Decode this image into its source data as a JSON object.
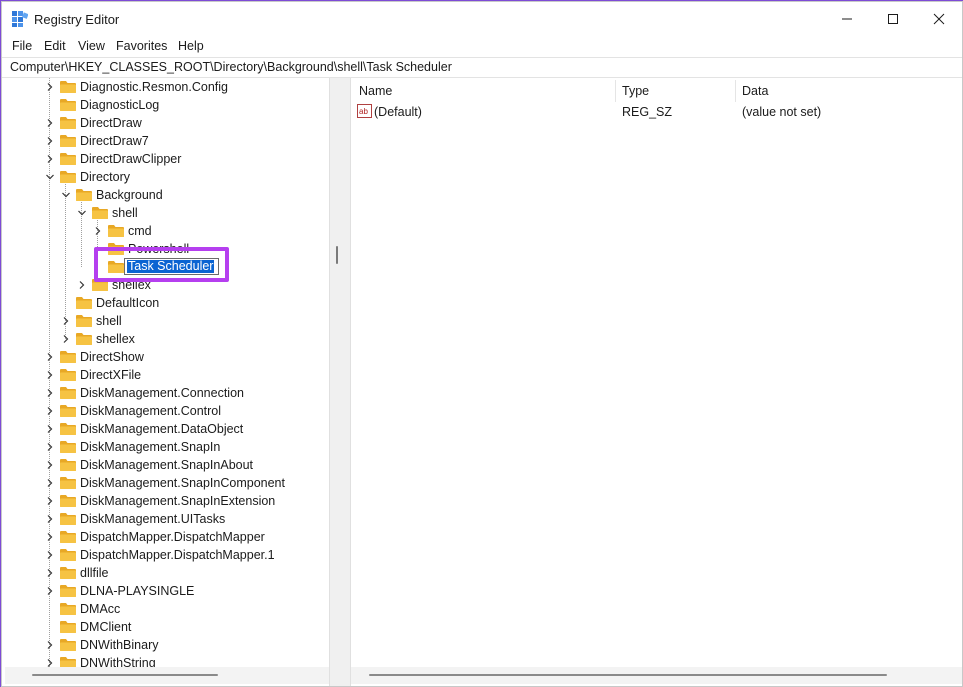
{
  "window": {
    "title": "Registry Editor"
  },
  "menu": [
    "File",
    "Edit",
    "View",
    "Favorites",
    "Help"
  ],
  "address": "Computer\\HKEY_CLASSES_ROOT\\Directory\\Background\\shell\\Task Scheduler",
  "tree": [
    {
      "label": "Diagnostic.Resmon.Config",
      "depth": 0,
      "expander": "collapsed"
    },
    {
      "label": "DiagnosticLog",
      "depth": 0,
      "expander": "none"
    },
    {
      "label": "DirectDraw",
      "depth": 0,
      "expander": "collapsed"
    },
    {
      "label": "DirectDraw7",
      "depth": 0,
      "expander": "collapsed"
    },
    {
      "label": "DirectDrawClipper",
      "depth": 0,
      "expander": "collapsed"
    },
    {
      "label": "Directory",
      "depth": 0,
      "expander": "expanded"
    },
    {
      "label": "Background",
      "depth": 1,
      "expander": "expanded"
    },
    {
      "label": "shell",
      "depth": 2,
      "expander": "expanded"
    },
    {
      "label": "cmd",
      "depth": 3,
      "expander": "collapsed"
    },
    {
      "label": "Powershell",
      "depth": 3,
      "expander": "none",
      "obscured": true
    },
    {
      "label": "",
      "depth": 3,
      "expander": "none",
      "renaming": true
    },
    {
      "label": "shellex",
      "depth": 2,
      "expander": "collapsed"
    },
    {
      "label": "DefaultIcon",
      "depth": 1,
      "expander": "none"
    },
    {
      "label": "shell",
      "depth": 1,
      "expander": "collapsed"
    },
    {
      "label": "shellex",
      "depth": 1,
      "expander": "collapsed"
    },
    {
      "label": "DirectShow",
      "depth": 0,
      "expander": "collapsed"
    },
    {
      "label": "DirectXFile",
      "depth": 0,
      "expander": "collapsed"
    },
    {
      "label": "DiskManagement.Connection",
      "depth": 0,
      "expander": "collapsed"
    },
    {
      "label": "DiskManagement.Control",
      "depth": 0,
      "expander": "collapsed"
    },
    {
      "label": "DiskManagement.DataObject",
      "depth": 0,
      "expander": "collapsed"
    },
    {
      "label": "DiskManagement.SnapIn",
      "depth": 0,
      "expander": "collapsed"
    },
    {
      "label": "DiskManagement.SnapInAbout",
      "depth": 0,
      "expander": "collapsed"
    },
    {
      "label": "DiskManagement.SnapInComponent",
      "depth": 0,
      "expander": "collapsed"
    },
    {
      "label": "DiskManagement.SnapInExtension",
      "depth": 0,
      "expander": "collapsed"
    },
    {
      "label": "DiskManagement.UITasks",
      "depth": 0,
      "expander": "collapsed"
    },
    {
      "label": "DispatchMapper.DispatchMapper",
      "depth": 0,
      "expander": "collapsed"
    },
    {
      "label": "DispatchMapper.DispatchMapper.1",
      "depth": 0,
      "expander": "collapsed"
    },
    {
      "label": "dllfile",
      "depth": 0,
      "expander": "collapsed"
    },
    {
      "label": "DLNA-PLAYSINGLE",
      "depth": 0,
      "expander": "collapsed"
    },
    {
      "label": "DMAcc",
      "depth": 0,
      "expander": "none"
    },
    {
      "label": "DMClient",
      "depth": 0,
      "expander": "none"
    },
    {
      "label": "DNWithBinary",
      "depth": 0,
      "expander": "collapsed"
    },
    {
      "label": "DNWithString",
      "depth": 0,
      "expander": "collapsed"
    }
  ],
  "rename": {
    "value": "Task Scheduler"
  },
  "list": {
    "columns": [
      "Name",
      "Type",
      "Data"
    ],
    "rows": [
      {
        "name": "(Default)",
        "type": "REG_SZ",
        "data": "(value not set)",
        "icon": "string-value-icon"
      }
    ]
  },
  "colors": {
    "accent_frame": "#b53fef",
    "selection": "#0a64d2",
    "folder": "#f6c343"
  }
}
